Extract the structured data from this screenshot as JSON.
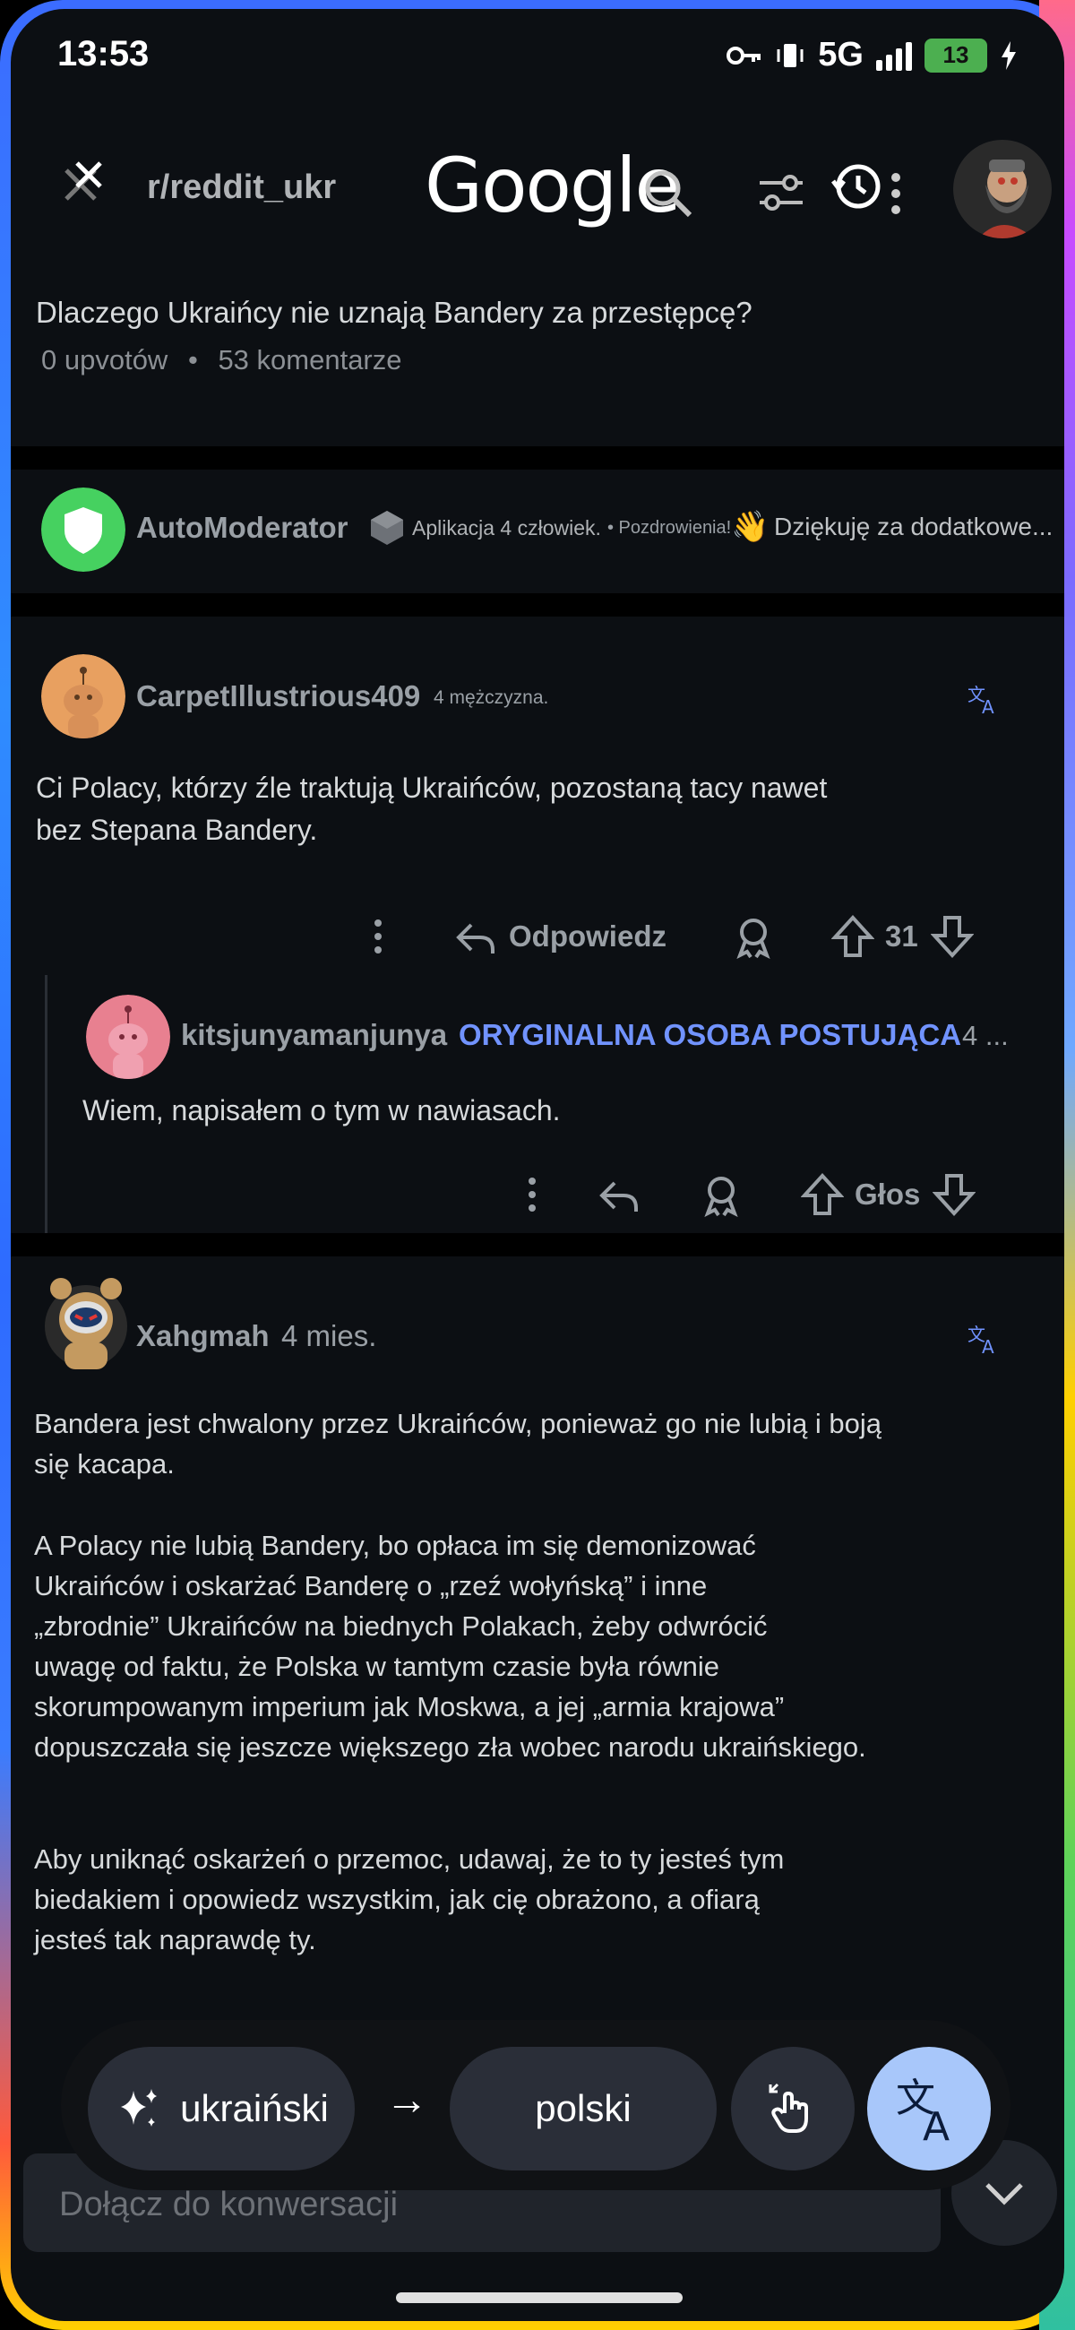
{
  "status_bar": {
    "time": "13:53",
    "network": "5G",
    "battery": "13"
  },
  "header": {
    "subreddit": "r/reddit_ukr",
    "google_logo": "Google"
  },
  "post": {
    "title": "Dlaczego Ukraińcy nie uznają Bandery za przestępcę?",
    "upvotes": "0 upvotów",
    "dot": "•",
    "comments": "53 komentarze"
  },
  "automod": {
    "username": "AutoModerator",
    "flair": "Aplikacja 4 człowiek.",
    "greeting": "• Pozdrowienia!",
    "wave": "👋",
    "preview": "Dziękuję za dodatkowe..."
  },
  "comment1": {
    "username": "CarpetIllustrious409",
    "flair": "4 mężczyzna.",
    "body_line1": "Ci Polacy, którzy źle traktują Ukraińców, pozostaną tacy nawet",
    "body_line2": "bez Stepana Bandery.",
    "reply_label": "Odpowiedz",
    "score": "31"
  },
  "reply1": {
    "username": "kitsjunyamanjunya",
    "op_badge": "ORYGINALNA OSOBA POSTUJĄCA",
    "age": "4 ...",
    "body": "Wiem, napisałem o tym w nawiasach.",
    "vote_label": "Głos"
  },
  "comment2": {
    "username": "Xahgmah",
    "age": "4 mies.",
    "p1_line1": "Bandera jest chwalony przez Ukraińców, ponieważ go nie lubią i boją",
    "p1_line2": "się kacapa.",
    "p2_line1": "A Polacy nie lubią Bandery, bo opłaca im się demonizować",
    "p2_line2": "Ukraińców i oskarżać Banderę o „rzeź wołyńską” i inne",
    "p2_line3": "„zbrodnie” Ukraińców na biednych Polakach, żeby odwrócić",
    "p2_line4": "uwagę od faktu, że Polska w tamtym czasie była równie",
    "p2_line5": "skorumpowanym imperium jak Moskwa, a jej „armia krajowa”",
    "p2_line6": "dopuszczała się jeszcze większego zła wobec narodu ukraińskiego.",
    "p3_line1": "Aby uniknąć oskarżeń o przemoc, udawaj, że to ty jesteś tym",
    "p3_line2": "biedakiem i opowiedz wszystkim, jak cię obrażono, a ofiarą",
    "p3_line3": "jesteś tak naprawdę ty."
  },
  "translate_bar": {
    "source_lang": "ukraiński",
    "arrow": "→",
    "target_lang": "polski"
  },
  "reply_box": {
    "placeholder": "Dołącz do konwersacji"
  },
  "colors": {
    "accent": "#7193ff",
    "translate_button": "#a8c7fa",
    "background": "#0c0f13"
  }
}
